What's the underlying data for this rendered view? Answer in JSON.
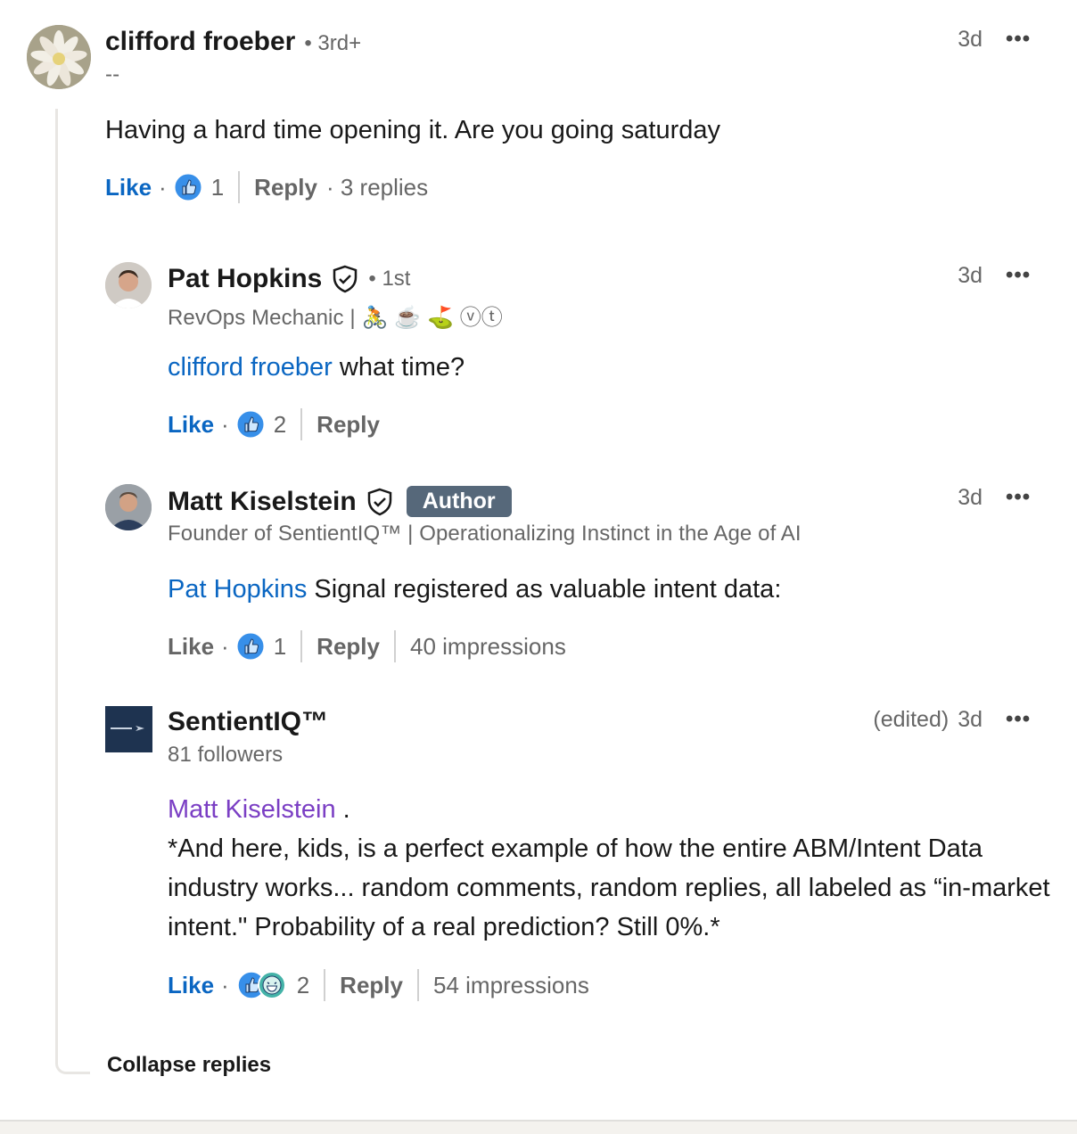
{
  "comment": {
    "author": "clifford froeber",
    "degree": "• 3rd+",
    "headline": "--",
    "time": "3d",
    "more": "•••",
    "text": "Having a hard time opening it. Are you going saturday",
    "like": "Like",
    "dot": "·",
    "reaction_count": "1",
    "reply": "Reply",
    "replies_count": "· 3 replies"
  },
  "replies": [
    {
      "author": "Pat Hopkins",
      "degree": "• 1st",
      "headline": "RevOps Mechanic | 🚴 ☕ ⛳ ⓥⓣ",
      "time": "3d",
      "more": "•••",
      "mention": "clifford froeber",
      "text": " what time?",
      "like": "Like",
      "dot": "·",
      "reaction_count": "2",
      "reply": "Reply"
    },
    {
      "author": "Matt Kiselstein",
      "badge": "Author",
      "headline": "Founder of SentientIQ™ | Operationalizing Instinct in the Age of AI",
      "time": "3d",
      "more": "•••",
      "mention": "Pat Hopkins",
      "text": " Signal registered as valuable intent data:",
      "like": "Like",
      "dot": "·",
      "reaction_count": "1",
      "reply": "Reply",
      "impressions": "40 impressions"
    },
    {
      "author": "SentientIQ™",
      "headline": "81 followers",
      "edited": "(edited)",
      "time": "3d",
      "more": "•••",
      "mention": "Matt Kiselstein",
      "mention_suffix": " .",
      "text": "*And here, kids, is a perfect example of how the entire ABM/Intent Data industry works... random comments, random replies, all labeled as “in-market intent.\" Probability of a real prediction? Still 0%.*",
      "like": "Like",
      "dot": "·",
      "reaction_count": "2",
      "reply": "Reply",
      "impressions": "54 impressions"
    }
  ],
  "collapse_label": "Collapse replies",
  "colors": {
    "link_blue": "#0a66c2",
    "mention_purple": "#7b3fc4",
    "badge_bg": "#56687a"
  }
}
